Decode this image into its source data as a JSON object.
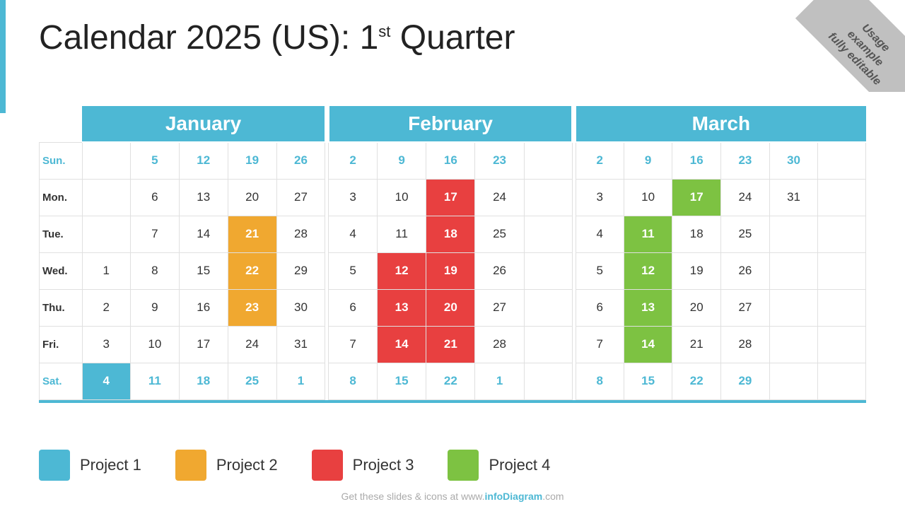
{
  "title": {
    "main": "Calendar 2025 (US): 1",
    "sup": "st",
    "rest": " Quarter"
  },
  "corner": {
    "line1": "Usage",
    "line2": "example",
    "line3": "fully editable"
  },
  "months": [
    "January",
    "February",
    "March"
  ],
  "days": [
    "Sun.",
    "Mon.",
    "Tue.",
    "Wed.",
    "Thu.",
    "Fri.",
    "Sat."
  ],
  "legend": [
    {
      "id": "proj1",
      "label": "Project 1",
      "color": "#4db8d4"
    },
    {
      "id": "proj2",
      "label": "Project 2",
      "color": "#f0a830"
    },
    {
      "id": "proj3",
      "label": "Project 3",
      "color": "#e84040"
    },
    {
      "id": "proj4",
      "label": "Project 4",
      "color": "#7dc242"
    }
  ],
  "footer": "Get these slides & icons at www.infoDiagram.com"
}
